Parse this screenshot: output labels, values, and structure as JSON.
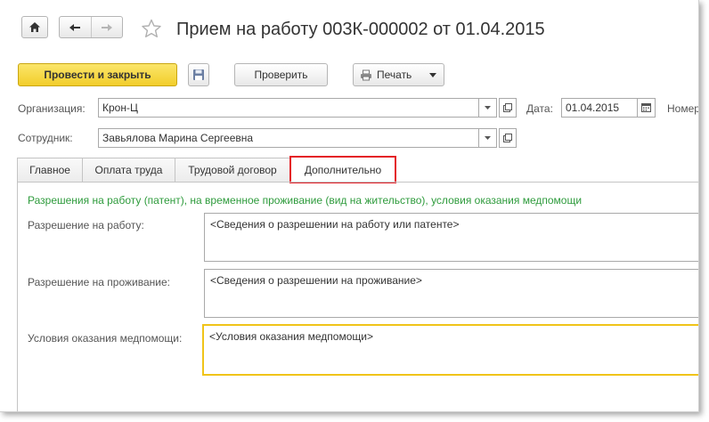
{
  "header": {
    "title": "Прием на работу 003К-000002 от 01.04.2015"
  },
  "toolbar": {
    "post_and_close": "Провести и закрыть",
    "check": "Проверить",
    "print": "Печать"
  },
  "form": {
    "organization_label": "Организация:",
    "organization_value": "Крон-Ц",
    "date_label": "Дата:",
    "date_value": "01.04.2015",
    "number_label": "Номер",
    "employee_label": "Сотрудник:",
    "employee_value": "Завьялова Марина Сергеевна"
  },
  "tabs": [
    {
      "label": "Главное"
    },
    {
      "label": "Оплата труда"
    },
    {
      "label": "Трудовой договор"
    },
    {
      "label": "Дополнительно"
    }
  ],
  "panel": {
    "section_title": "Разрешения на работу (патент), на временное проживание (вид на жительство), условия оказания медпомощи",
    "work_permit_label": "Разрешение на работу:",
    "work_permit_value": "<Сведения о разрешении на работу или патенте>",
    "residence_label": "Разрешение на проживание:",
    "residence_value": "<Сведения о разрешении на проживание>",
    "medical_label": "Условия оказания медпомощи:",
    "medical_value": "<Условия оказания медпомощи>"
  },
  "colors": {
    "primary_button": "#f5d43a",
    "section_title": "#2e9b3c",
    "active_tab_border": "#e41e26",
    "focused_field_border": "#f0c419"
  }
}
